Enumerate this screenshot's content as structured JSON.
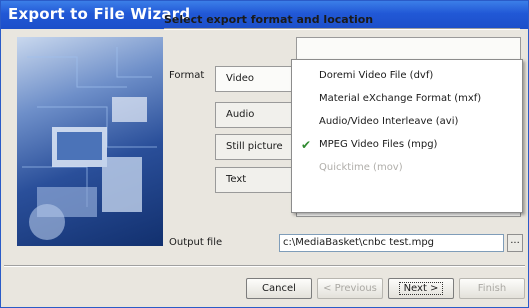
{
  "window": {
    "title": "Export to File Wizard"
  },
  "page": {
    "heading": "Select export format and location"
  },
  "format": {
    "label": "Format",
    "tabs": [
      "Video",
      "Audio",
      "Still picture",
      "Text"
    ],
    "menu_items": [
      {
        "label": "Doremi Video File (dvf)",
        "checked": false,
        "disabled": false
      },
      {
        "label": "Material eXchange Format (mxf)",
        "checked": false,
        "disabled": false
      },
      {
        "label": "Audio/Video Interleave (avi)",
        "checked": false,
        "disabled": false
      },
      {
        "label": "MPEG Video Files (mpg)",
        "checked": true,
        "disabled": false
      },
      {
        "label": "Quicktime (mov)",
        "checked": false,
        "disabled": true
      }
    ]
  },
  "output": {
    "label": "Output file",
    "value": "c:\\MediaBasket\\cnbc test.mpg",
    "browse_label": "..."
  },
  "buttons": {
    "cancel": "Cancel",
    "previous": "< Previous",
    "next": "Next >",
    "finish": "Finish"
  },
  "colors": {
    "titlebar": "#2158d6",
    "check": "#2f8a2f"
  }
}
